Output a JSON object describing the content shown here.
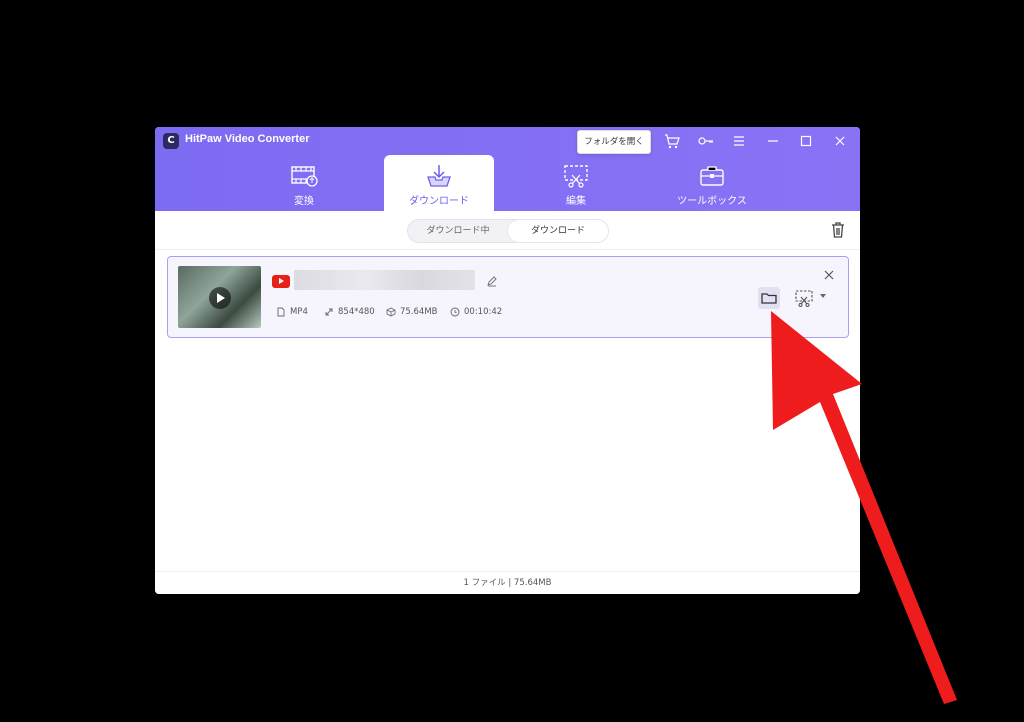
{
  "app": {
    "title": "HitPaw Video Converter",
    "logo_letter": "C"
  },
  "tabs": [
    {
      "label": "変換"
    },
    {
      "label": "ダウンロード"
    },
    {
      "label": "編集"
    },
    {
      "label": "ツールボックス"
    }
  ],
  "download": {
    "segments": [
      "ダウンロード中",
      "ダウンロード"
    ],
    "item": {
      "format": "MP4",
      "resolution": "854*480",
      "size": "75.64MB",
      "duration": "00:10:42"
    },
    "tooltip": "フォルダを開く"
  },
  "status": {
    "summary": "1 ファイル | 75.64MB"
  },
  "colors": {
    "accent": "#7c6cf2",
    "arrow": "#ee1c1c",
    "youtube": "#e62117"
  }
}
